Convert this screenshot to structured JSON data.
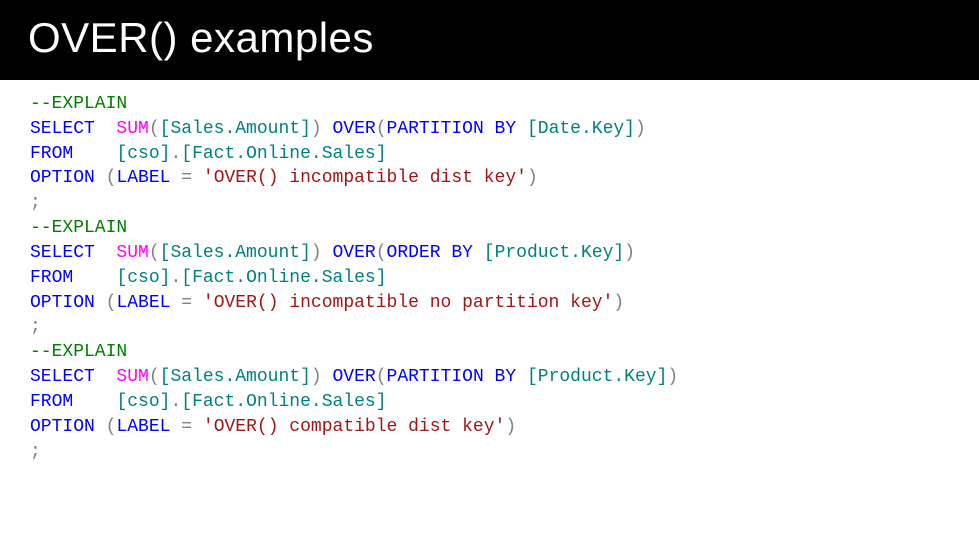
{
  "title": "OVER() examples",
  "code": {
    "kw": {
      "select": "SELECT",
      "from": "FROM",
      "option": "OPTION",
      "label": "LABEL",
      "over": "OVER",
      "partitionBy": "PARTITION BY",
      "orderBy": "ORDER BY"
    },
    "fn": {
      "sum": "SUM"
    },
    "id": {
      "salesAmount": "[Sales.Amount]",
      "dateKey": "[Date.Key]",
      "productKey": "[Product.Key]",
      "cso": "[cso]",
      "factOnlineSales": "[Fact.Online.Sales]"
    },
    "pun": {
      "lpar": "(",
      "rpar": ")",
      "dot": ".",
      "eq": "=",
      "semi": ";"
    },
    "block1": {
      "comment": "--EXPLAIN",
      "label": "'OVER() incompatible dist key'"
    },
    "block2": {
      "comment": "--EXPLAIN",
      "label": "'OVER() incompatible no partition key'"
    },
    "block3": {
      "comment": "--EXPLAIN",
      "label": "'OVER() compatible dist key'"
    }
  }
}
